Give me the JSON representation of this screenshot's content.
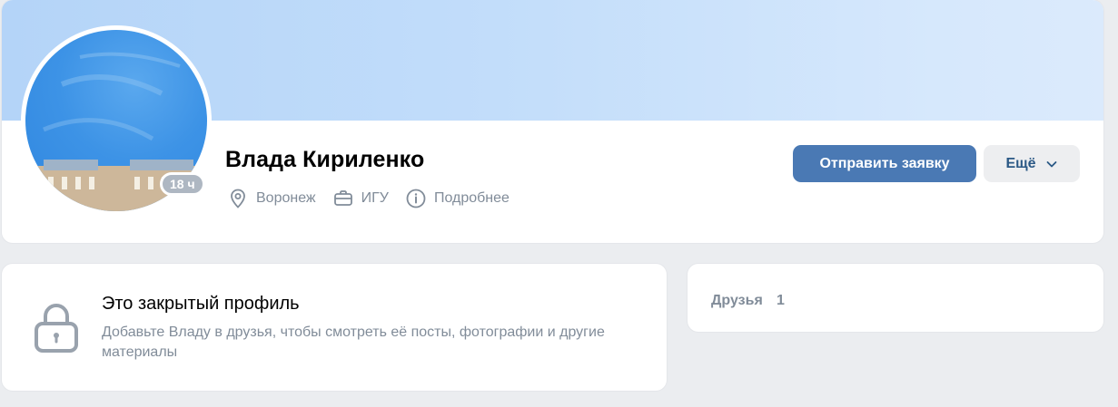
{
  "profile": {
    "name": "Влада Кириленко",
    "online_badge": "18 ч",
    "meta": {
      "city": "Воронеж",
      "university": "ИГУ",
      "more_info": "Подробнее"
    },
    "actions": {
      "send_request": "Отправить заявку",
      "more": "Ещё"
    }
  },
  "closed_profile": {
    "title": "Это закрытый профиль",
    "description": "Добавьте Владу в друзья, чтобы смотреть её посты, фотографии и другие материалы"
  },
  "friends": {
    "label": "Друзья",
    "count": "1"
  },
  "colors": {
    "accent": "#4a79b4",
    "secondary_text": "#818c99",
    "background": "#ebedf0"
  }
}
